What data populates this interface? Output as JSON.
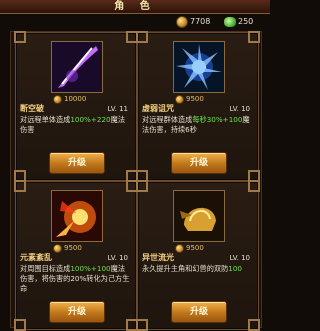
{
  "header": {
    "title": "角 色"
  },
  "currency": {
    "gold": "7708",
    "gems": "250"
  },
  "skills": [
    {
      "name": "断空破",
      "level": "LV. 11",
      "cost": "10000",
      "desc_pre": "对远程单体造成",
      "desc_hl": "100%+220",
      "desc_post": "魔法伤害",
      "button": "升级",
      "icon": "purple-slash-icon"
    },
    {
      "name": "虚弱诅咒",
      "level": "LV. 10",
      "cost": "9500",
      "desc_pre": "对远程群体造成",
      "desc_hl": "每秒30%+100",
      "desc_post": "魔法伤害，持续6秒",
      "button": "升级",
      "icon": "blue-lightning-icon"
    },
    {
      "name": "元素紊乱",
      "level": "LV. 10",
      "cost": "9500",
      "desc_pre": "对周围目标造成",
      "desc_hl": "100%+100",
      "desc_post": "魔法伤害，将伤害的20%转化为己方生命",
      "button": "升级",
      "icon": "fire-burst-icon"
    },
    {
      "name": "异世流光",
      "level": "LV. 10",
      "cost": "9500",
      "desc_pre": "永久提升主角和幻兽的双防",
      "desc_hl": "",
      "desc_post": "100",
      "button": "升级",
      "icon": "golden-helm-icon"
    }
  ],
  "colors": {
    "highlight": "#6ee04a",
    "title": "#f5d080",
    "button": "#e09a30"
  }
}
